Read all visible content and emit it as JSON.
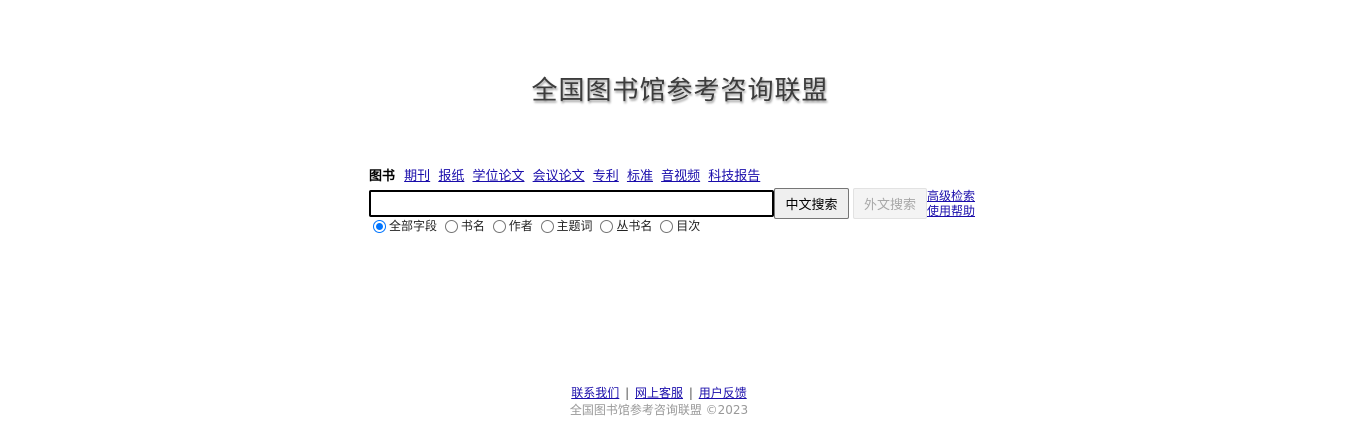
{
  "logo": {
    "text": "全国图书馆参考咨询联盟"
  },
  "tabs": [
    {
      "label": "图书",
      "active": true
    },
    {
      "label": "期刊",
      "active": false
    },
    {
      "label": "报纸",
      "active": false
    },
    {
      "label": "学位论文",
      "active": false
    },
    {
      "label": "会议论文",
      "active": false
    },
    {
      "label": "专利",
      "active": false
    },
    {
      "label": "标准",
      "active": false
    },
    {
      "label": "音视频",
      "active": false
    },
    {
      "label": "科技报告",
      "active": false
    }
  ],
  "search": {
    "value": "",
    "placeholder": ""
  },
  "buttons": {
    "chinese_search": "中文搜索",
    "foreign_search": "外文搜索"
  },
  "side_links": {
    "advanced": "高级检索",
    "help": "使用帮助"
  },
  "fields": {
    "selected": "全部字段",
    "options": [
      "全部字段",
      "书名",
      "作者",
      "主题词",
      "丛书名",
      "目次"
    ]
  },
  "footer": {
    "contact": "联系我们",
    "service": "网上客服",
    "feedback": "用户反馈",
    "separator": "|",
    "copyright": "全国图书馆参考咨询联盟 ©2023"
  },
  "colors": {
    "link": "#1a0dab",
    "radio_accent": "#0075ff",
    "copyright": "#999999"
  }
}
